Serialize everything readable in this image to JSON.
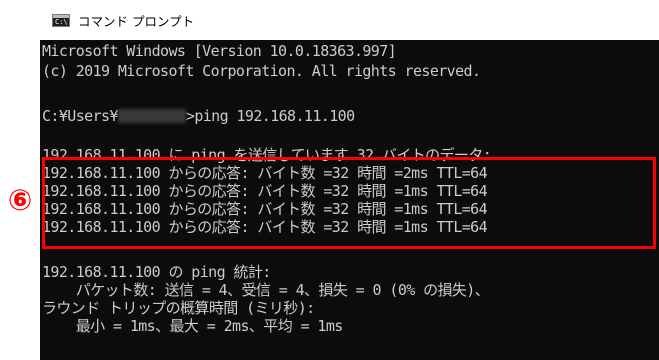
{
  "window": {
    "title": "コマンド プロンプト",
    "icon_text": "C:\\"
  },
  "console": {
    "header1": "Microsoft Windows [Version 10.0.18363.997]",
    "header2": "(c) 2019 Microsoft Corporation. All rights reserved.",
    "prompt_prefix": "C:¥Users¥",
    "prompt_suffix": ">ping 192.168.11.100",
    "ping_intro": "192.168.11.100 に ping を送信しています 32 バイトのデータ:",
    "replies": [
      "192.168.11.100 からの応答: バイト数 =32 時間 =2ms TTL=64",
      "192.168.11.100 からの応答: バイト数 =32 時間 =1ms TTL=64",
      "192.168.11.100 からの応答: バイト数 =32 時間 =1ms TTL=64",
      "192.168.11.100 からの応答: バイト数 =32 時間 =1ms TTL=64"
    ],
    "stats_header": "192.168.11.100 の ping 統計:",
    "stats_packets": "    パケット数: 送信 = 4、受信 = 4、損失 = 0 (0% の損失)、",
    "stats_rtt_header": "ラウンド トリップの概算時間 (ミリ秒):",
    "stats_rtt": "    最小 = 1ms、最大 = 2ms、平均 = 1ms"
  },
  "annotation": {
    "marker": "⑥",
    "color": "#ff0000"
  },
  "colors": {
    "console_bg": "#0c0c0c",
    "console_fg": "#cccccc",
    "titlebar_bg": "#ffffff"
  }
}
